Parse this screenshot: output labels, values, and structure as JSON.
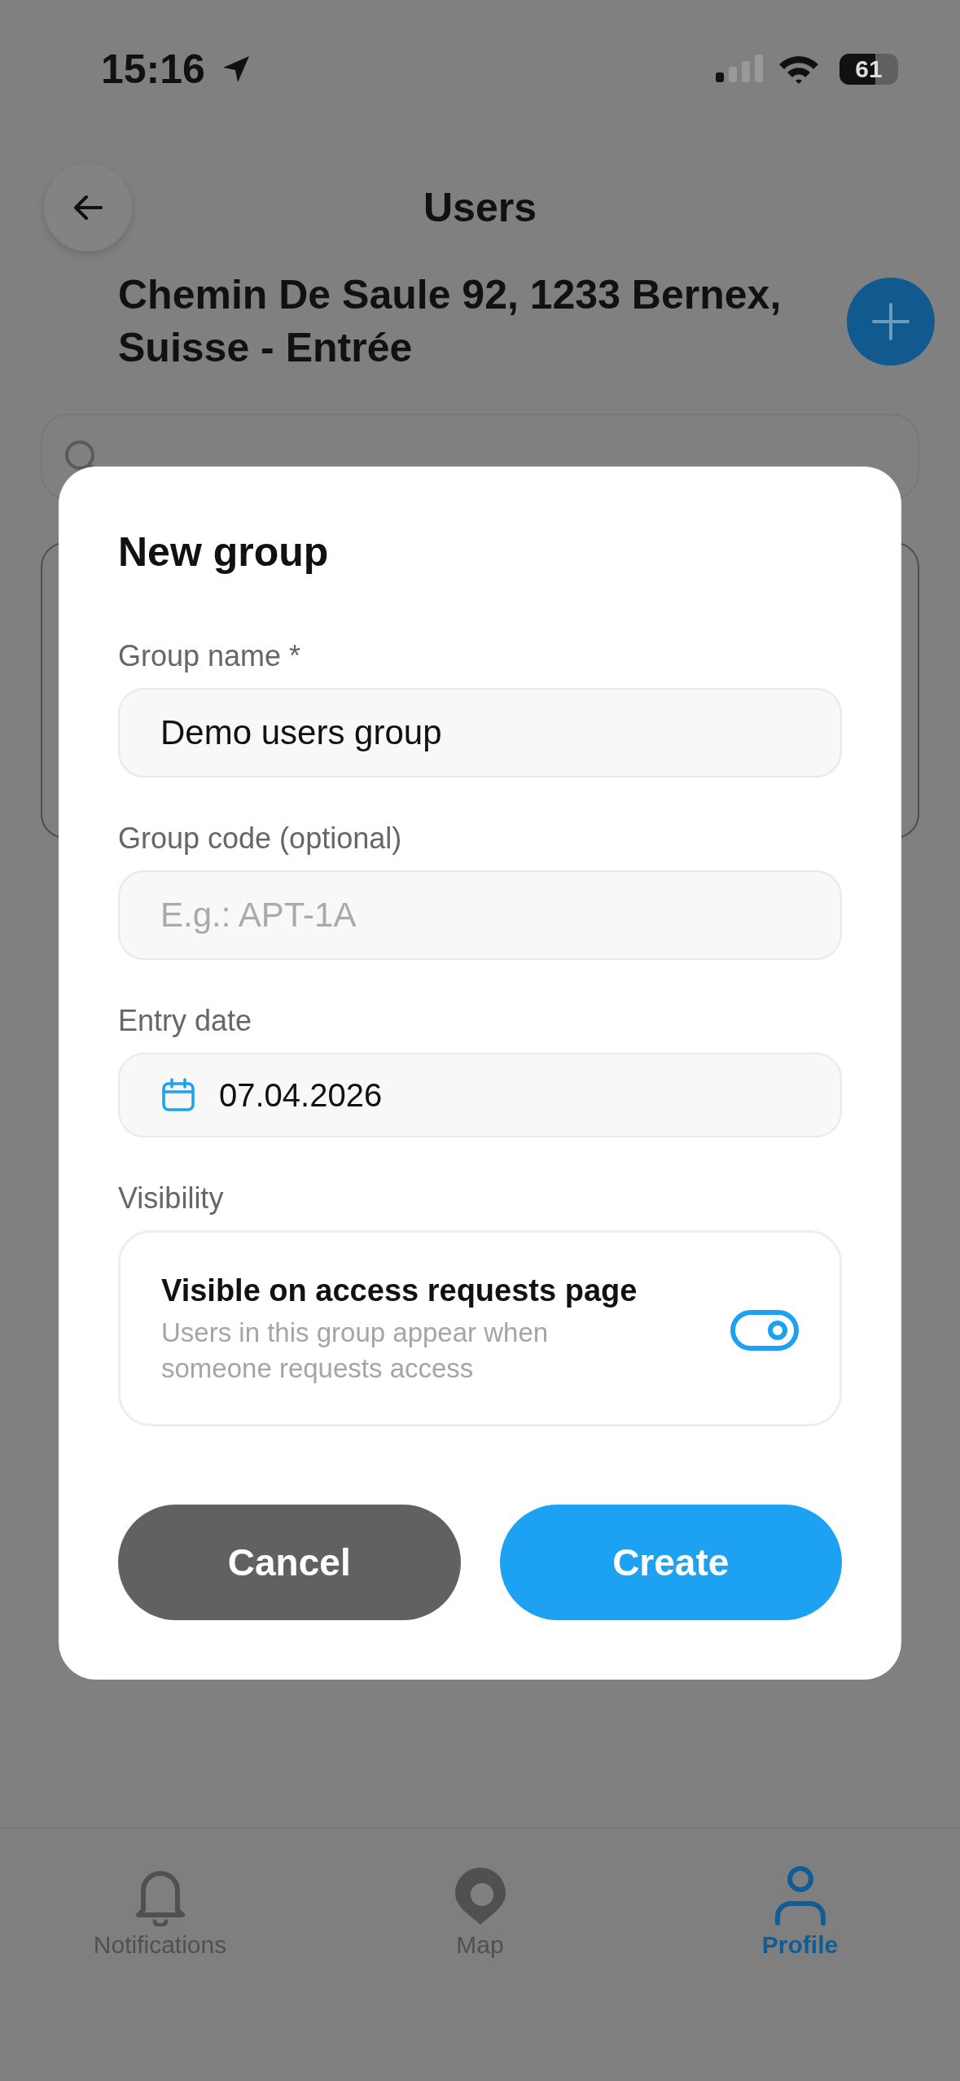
{
  "status_bar": {
    "time": "15:16",
    "battery": "61"
  },
  "header": {
    "title": "Users",
    "address": "Chemin De Saule 92, 1233 Bernex, Suisse - Entrée"
  },
  "dialog": {
    "title": "New group",
    "fields": [
      {
        "kind": "text",
        "label": "Group name *",
        "value": "Demo users group"
      },
      {
        "kind": "text",
        "label": "Group code (optional)",
        "placeholder": "E.g.: APT-1A"
      },
      {
        "kind": "date",
        "label": "Entry date",
        "value": "07.04.2026"
      }
    ],
    "visibility": {
      "label": "Visibility",
      "title": "Visible on access requests page",
      "description": "Users in this group appear when someone requests access",
      "on": true
    },
    "buttons": [
      {
        "kind": "secondary",
        "label": "Cancel"
      },
      {
        "kind": "primary",
        "label": "Create"
      }
    ]
  },
  "tab_bar": [
    {
      "label": "Notifications",
      "selected": false
    },
    {
      "label": "Map",
      "selected": false
    },
    {
      "label": "Profile",
      "selected": true
    }
  ]
}
